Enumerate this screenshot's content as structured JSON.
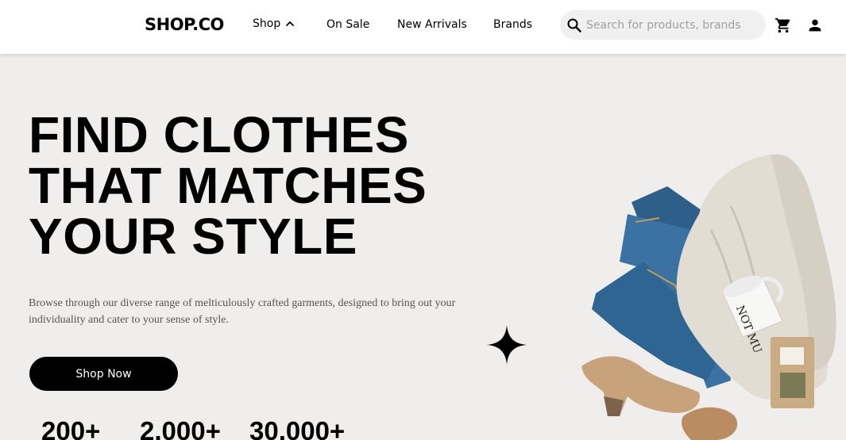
{
  "header": {
    "logo": "SHOP.CO",
    "nav": {
      "shop": "Shop",
      "on_sale": "On Sale",
      "new_arrivals": "New Arrivals",
      "brands": "Brands"
    },
    "search": {
      "placeholder": "Search for products, brands and more"
    },
    "icons": [
      "search-icon",
      "cart-icon",
      "user-icon",
      "chevron-up-icon"
    ]
  },
  "hero": {
    "title_lines": [
      "FIND CLOTHES",
      "THAT MATCHES",
      "YOUR STYLE"
    ],
    "description": "Browse through our diverse range of melticulously crafted garments, designed to bring out your individuality and cater to your sense of style.",
    "cta_label": "Shop Now",
    "stats": [
      "200+",
      "2,000+",
      "30,000+"
    ]
  },
  "colors": {
    "background": "#f0eeed",
    "header_bg": "#ffffff",
    "button_bg": "#000000",
    "button_text": "#ffffff",
    "search_bg": "#f0f0f0"
  }
}
